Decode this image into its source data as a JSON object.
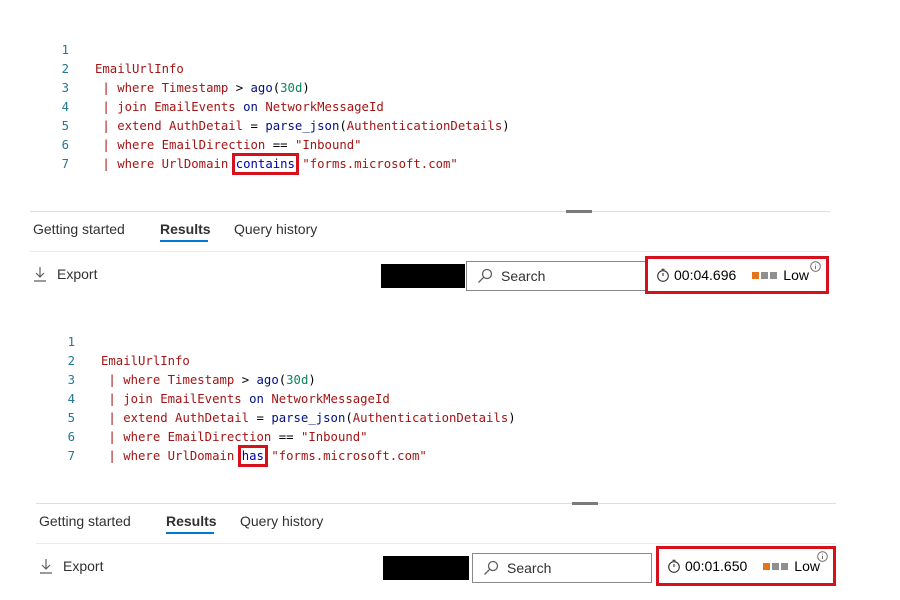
{
  "colors": {
    "highlight_box": "#d7111b",
    "tab_underline": "#0078d4",
    "perf_active": "#e3761b",
    "perf_inactive": "#8f8f8f"
  },
  "panels": [
    {
      "code": {
        "line_numbers": [
          "1",
          "2",
          "3",
          "4",
          "5",
          "6",
          "7"
        ],
        "table": "EmailUrlInfo",
        "l2": {
          "pipe": "|",
          "kw": "where",
          "field": "Timestamp",
          "op": ">",
          "fn": "ago",
          "open": "(",
          "num": "30d",
          "close": ")"
        },
        "l3": {
          "pipe": "|",
          "kw": "join",
          "table": "EmailEvents",
          "on": "on",
          "field": "NetworkMessageId"
        },
        "l4": {
          "pipe": "|",
          "kw": "extend",
          "field": "AuthDetail",
          "op": "=",
          "fn": "parse_json",
          "open": "(",
          "arg": "AuthenticationDetails",
          "close": ")"
        },
        "l5": {
          "pipe": "|",
          "kw": "where",
          "field": "EmailDirection",
          "op": "==",
          "str": "\"Inbound\""
        },
        "l6": {
          "pipe": "|",
          "kw": "where",
          "field": "UrlDomain",
          "operator": "contains",
          "str": "\"forms.microsoft.com\""
        }
      },
      "tabs": [
        "Getting started",
        "Results",
        "Query history"
      ],
      "active_tab": "Results",
      "export_label": "Export",
      "search_placeholder": "Search",
      "duration": "00:04.696",
      "perf_level": "Low",
      "perf_bars_active": 1
    },
    {
      "code": {
        "line_numbers": [
          "1",
          "2",
          "3",
          "4",
          "5",
          "6",
          "7"
        ],
        "table": "EmailUrlInfo",
        "l2": {
          "pipe": "|",
          "kw": "where",
          "field": "Timestamp",
          "op": ">",
          "fn": "ago",
          "open": "(",
          "num": "30d",
          "close": ")"
        },
        "l3": {
          "pipe": "|",
          "kw": "join",
          "table": "EmailEvents",
          "on": "on",
          "field": "NetworkMessageId"
        },
        "l4": {
          "pipe": "|",
          "kw": "extend",
          "field": "AuthDetail",
          "op": "=",
          "fn": "parse_json",
          "open": "(",
          "arg": "AuthenticationDetails",
          "close": ")"
        },
        "l5": {
          "pipe": "|",
          "kw": "where",
          "field": "EmailDirection",
          "op": "==",
          "str": "\"Inbound\""
        },
        "l6": {
          "pipe": "|",
          "kw": "where",
          "field": "UrlDomain",
          "operator": "has",
          "str": "\"forms.microsoft.com\""
        }
      },
      "tabs": [
        "Getting started",
        "Results",
        "Query history"
      ],
      "active_tab": "Results",
      "export_label": "Export",
      "search_placeholder": "Search",
      "duration": "00:01.650",
      "perf_level": "Low",
      "perf_bars_active": 1
    }
  ]
}
